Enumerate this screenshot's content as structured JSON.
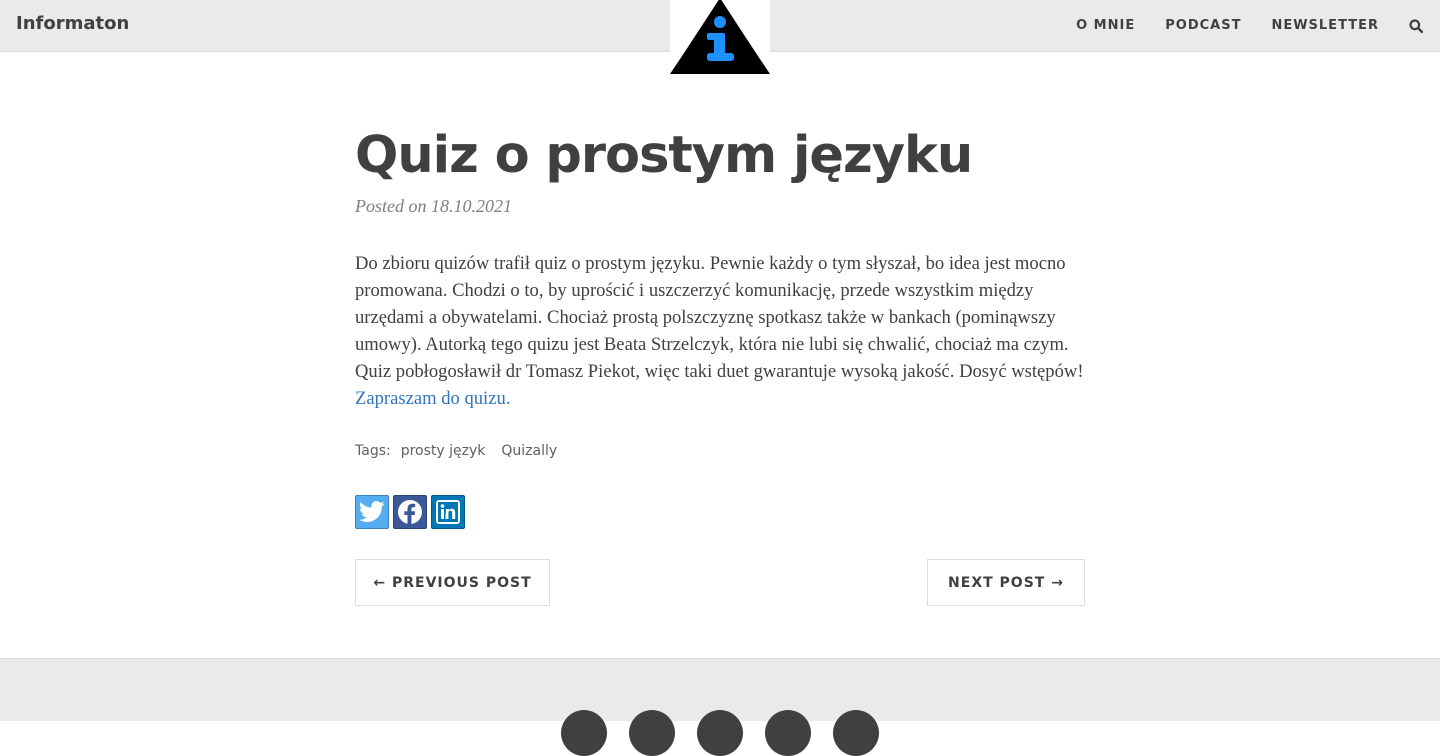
{
  "nav": {
    "brand": "Informaton",
    "links": [
      "O MNIE",
      "PODCAST",
      "NEWSLETTER"
    ],
    "search_icon": "search-icon",
    "logo": "info-triangle-logo"
  },
  "post": {
    "title": "Quiz o prostym języku",
    "meta": "Posted on 18.10.2021",
    "body_text": "Do zbioru quizów trafił quiz o prostym języku. Pewnie każdy o tym słyszał, bo idea jest mocno promowana. Chodzi o to, by uprościć i uszczerzyć komunikację, przede wszystkim między urzędami a obywatelami. Chociaż prostą polszczyznę spotkasz także w bankach (pominąwszy umowy). Autorką tego quizu jest Beata Strzelczyk, która nie lubi się chwalić, chociaż ma czym. Quiz pobłogosławił dr Tomasz Piekot, więc taki duet gwarantuje wysoką jakość. Dosyć wstępów!",
    "link_text": "Zapraszam do quizu."
  },
  "tags": {
    "label": "Tags:",
    "items": [
      "prosty język",
      "Quizally"
    ]
  },
  "share": {
    "icons": [
      "twitter-icon",
      "facebook-icon",
      "linkedin-icon"
    ],
    "colors": {
      "twitter": "#55acee",
      "facebook": "#3b5998",
      "linkedin": "#0077b5"
    }
  },
  "pager": {
    "previous": "← PREVIOUS POST",
    "next": "NEXT POST →"
  },
  "footer": {
    "icons": [
      "social-icon-1",
      "social-icon-2",
      "social-icon-3",
      "social-icon-4",
      "social-icon-5"
    ]
  }
}
